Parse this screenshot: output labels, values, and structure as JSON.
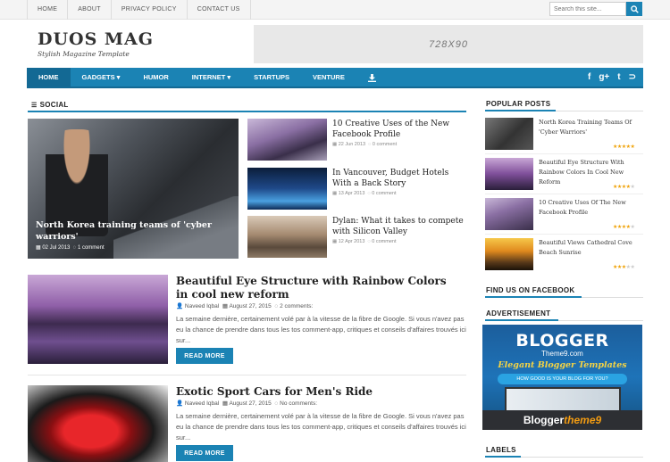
{
  "topnav": [
    "HOME",
    "ABOUT",
    "PRIVACY POLICY",
    "CONTACT US"
  ],
  "search": {
    "placeholder": "Search this site..."
  },
  "header": {
    "logo": "DUOS MAG",
    "tagline": "Stylish Magazine Template",
    "ad": "728X90"
  },
  "mainnav": {
    "items": [
      "HOME",
      "GADGETS ▾",
      "HUMOR",
      "INTERNET ▾",
      "STARTUPS",
      "VENTURE"
    ],
    "social_icons": [
      "facebook-icon",
      "google-plus-icon",
      "twitter-icon",
      "rss-icon"
    ],
    "social_glyphs": [
      "f",
      "g+",
      "t",
      "⊃"
    ]
  },
  "social": {
    "heading": "SOCIAL",
    "featured": {
      "title": "North Korea training teams of 'cyber warriors'",
      "date": "02 Jul 2013",
      "comments": "1 comment"
    },
    "small": [
      {
        "title": "10 Creative Uses of the New Facebook Profile",
        "date": "22 Jun 2013",
        "comments": "0 comment"
      },
      {
        "title": "In Vancouver, Budget Hotels With a Back Story",
        "date": "13 Apr 2013",
        "comments": "0 comment"
      },
      {
        "title": "Dylan: What it takes to compete with Silicon Valley",
        "date": "12 Apr 2013",
        "comments": "0 comment"
      }
    ]
  },
  "posts": [
    {
      "title": "Beautiful Eye Structure with Rainbow Colors in cool new reform",
      "author": "Naveed Iqbal",
      "date": "August 27, 2015",
      "comments": "2 comments:",
      "excerpt": "La semaine dernière, certainement volé par à la vitesse de la fibre de Google. Si vous n'avez pas eu la chance de prendre dans tous les tos comment-app, critiques et conseils d'affaires trouvés ici sur...",
      "read_more": "READ MORE"
    },
    {
      "title": "Exotic Sport Cars for Men's Ride",
      "author": "Naveed Iqbal",
      "date": "August 27, 2015",
      "comments": "No comments:",
      "excerpt": "La semaine dernière, certainement volé par à la vitesse de la fibre de Google. Si vous n'avez pas eu la chance de prendre dans tous les tos comment-app, critiques et conseils d'affaires trouvés ici sur...",
      "read_more": "READ MORE"
    }
  ],
  "sidebar": {
    "popular_heading": "POPULAR POSTS",
    "popular": [
      {
        "title": "North Korea Training Teams Of 'Cyber Warriors'",
        "rating": 5
      },
      {
        "title": "Beautiful Eye Structure With Rainbow Colors In Cool New Reform",
        "rating": 4
      },
      {
        "title": "10 Creative Uses Of The New Facebook Profile",
        "rating": 4
      },
      {
        "title": "Beautiful Views Cathedral Cove Beach Sunrise",
        "rating": 3
      }
    ],
    "facebook_heading": "FIND US ON FACEBOOK",
    "ad_heading": "ADVERTISEMENT",
    "ad": {
      "brand": "BLOGGER",
      "site": "Theme9.com",
      "tag": "Elegant Blogger Templates",
      "question": "HOW GOOD IS YOUR BLOG FOR YOU?",
      "footer": "Blogger",
      "footer_accent": "theme9"
    },
    "labels_heading": "LABELS"
  },
  "colors": {
    "accent": "#1b83b4",
    "accent_dark": "#136994",
    "star": "#f0a30a"
  }
}
